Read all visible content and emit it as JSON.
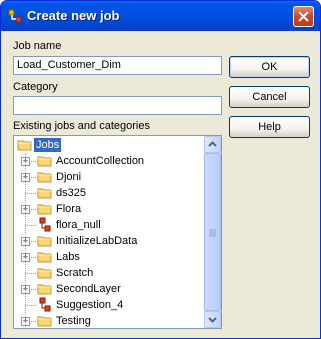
{
  "window": {
    "title": "Create new job",
    "close_icon": "close-icon"
  },
  "form": {
    "job_name_label": "Job name",
    "job_name_value": "Load_Customer_Dim",
    "category_label": "Category",
    "category_value": "",
    "tree_label": "Existing jobs and categories"
  },
  "buttons": {
    "ok": "OK",
    "cancel": "Cancel",
    "help": "Help"
  },
  "tree": {
    "root": "Jobs",
    "items": [
      {
        "label": "AccountCollection",
        "kind": "folder",
        "expandable": true
      },
      {
        "label": "Djoni",
        "kind": "folder",
        "expandable": true
      },
      {
        "label": "ds325",
        "kind": "folder",
        "expandable": false
      },
      {
        "label": "Flora",
        "kind": "folder",
        "expandable": true
      },
      {
        "label": "flora_null",
        "kind": "job",
        "expandable": false
      },
      {
        "label": "InitializeLabData",
        "kind": "folder",
        "expandable": true
      },
      {
        "label": "Labs",
        "kind": "folder",
        "expandable": true
      },
      {
        "label": "Scratch",
        "kind": "folder",
        "expandable": false
      },
      {
        "label": "SecondLayer",
        "kind": "folder",
        "expandable": true
      },
      {
        "label": "Suggestion_4",
        "kind": "job",
        "expandable": false
      },
      {
        "label": "Testing",
        "kind": "folder",
        "expandable": true
      }
    ]
  },
  "colors": {
    "titlebar": "#0053e5",
    "selection": "#316ac5",
    "dialog_bg": "#ece9d8"
  }
}
